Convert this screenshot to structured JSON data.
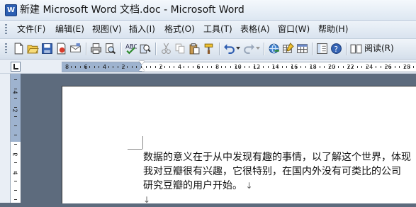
{
  "window": {
    "title": "新建 Microsoft Word 文档.doc - Microsoft Word",
    "app_icon_letter": "W"
  },
  "menu": [
    {
      "label": "文件(F)"
    },
    {
      "label": "编辑(E)"
    },
    {
      "label": "视图(V)"
    },
    {
      "label": "插入(I)"
    },
    {
      "label": "格式(O)"
    },
    {
      "label": "工具(T)"
    },
    {
      "label": "表格(A)"
    },
    {
      "label": "窗口(W)"
    },
    {
      "label": "帮助(H)"
    }
  ],
  "toolbar": {
    "icons": [
      "new-document-icon",
      "open-icon",
      "save-icon",
      "permission-icon",
      "email-icon",
      "print-icon",
      "print-preview-icon",
      "spelling-icon",
      "research-icon",
      "cut-icon",
      "copy-icon",
      "paste-icon",
      "format-painter-icon",
      "undo-icon",
      "redo-icon",
      "hyperlink-icon",
      "tables-borders-icon",
      "insert-table-icon",
      "document-map-icon",
      "help-icon",
      "read-icon"
    ],
    "read_label": "阅读(R)"
  },
  "ruler": {
    "horizontal_numbers": [
      "8",
      "6",
      "4",
      "2",
      "2",
      "4",
      "6",
      "8",
      "10",
      "12",
      "14",
      "16",
      "18",
      "20",
      "22",
      "24",
      "26",
      "28"
    ],
    "vertical_numbers": [
      "4",
      "2",
      "2",
      "4"
    ]
  },
  "document": {
    "lines": [
      "数据的意义在于从中发现有趣的事情，以了解这个世界，体现",
      "我对豆瓣很有兴趣，它很特别，在国内外没有可类比的公司",
      "研究豆瓣的用户开始。"
    ],
    "paragraph_mark": "↓"
  },
  "colors": {
    "workspace": "#5d6b7d",
    "ruler_margin": "#9eb3cf",
    "toolbar_gradient_top": "#f1f5fa",
    "toolbar_gradient_bottom": "#d5dfeb"
  }
}
